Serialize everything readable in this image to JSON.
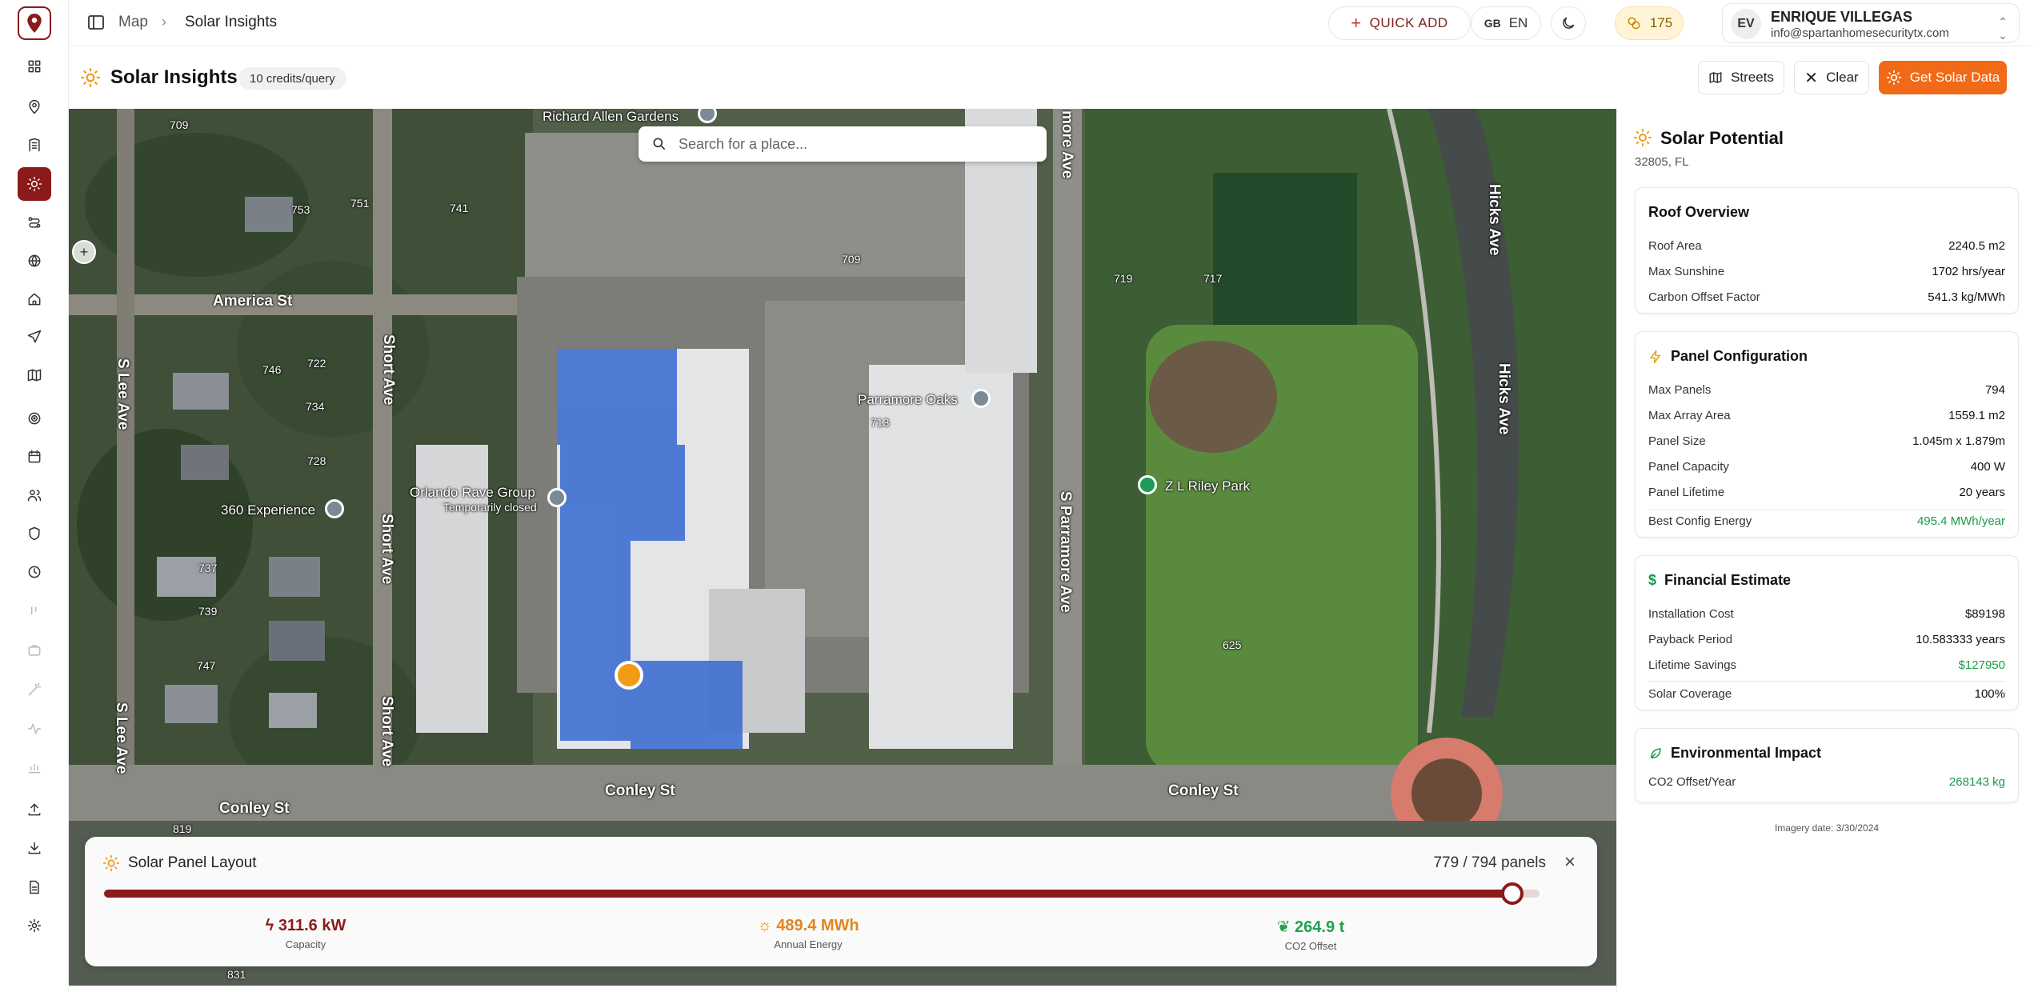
{
  "breadcrumb": {
    "parent": "Map",
    "current": "Solar Insights"
  },
  "header": {
    "quick_add": "QUICK ADD",
    "lang_flag": "GB",
    "lang_code": "EN",
    "credits": "175",
    "user_initials": "EV",
    "user_name": "ENRIQUE VILLEGAS",
    "user_email": "info@spartanhomesecuritytx.com"
  },
  "page": {
    "title": "Solar Insights",
    "credit_badge": "10 credits/query",
    "btn_streets": "Streets",
    "btn_clear": "Clear",
    "btn_get_solar": "Get Solar Data"
  },
  "map": {
    "search_placeholder": "Search for a place...",
    "labels": {
      "richard_allen": "Richard Allen Gardens",
      "america_st": "America St",
      "short_ave_1": "Short Ave",
      "short_ave_2": "Short Ave",
      "short_ave_3": "Short Ave",
      "s_lee_ave_1": "S Lee Ave",
      "s_lee_ave_2": "S Lee Ave",
      "experience": "360 Experience",
      "orlando_rave": "Orlando Rave Group",
      "temporarily_closed": "Temporarily closed",
      "parramore_oaks": "Parramore Oaks",
      "more_ave": "more Ave",
      "s_parramore": "S Parramore Ave",
      "zl_riley": "Z L Riley Park",
      "hicks_ave_1": "Hicks Ave",
      "hicks_ave_2": "Hicks Ave",
      "conley_st_1": "Conley St",
      "conley_st_2": "Conley St",
      "conley_st_3": "Conley St"
    },
    "numbers": {
      "n709a": "709",
      "n753": "753",
      "n751": "751",
      "n741": "741",
      "n709b": "709",
      "n719": "719",
      "n717": "717",
      "n722": "722",
      "n746": "746",
      "n734": "734",
      "n728": "728",
      "n713": "713",
      "n737": "737",
      "n739": "739",
      "n747": "747",
      "n625": "625",
      "n819": "819",
      "n831": "831"
    }
  },
  "layout_panel": {
    "title": "Solar Panel Layout",
    "count": "779 / 794 panels",
    "fill_fraction": 0.981,
    "capacity": "311.6 kW",
    "capacity_label": "Capacity",
    "energy": "489.4 MWh",
    "energy_label": "Annual Energy",
    "co2": "264.9 t",
    "co2_label": "CO2 Offset"
  },
  "solar_potential": {
    "title": "Solar Potential",
    "location": "32805, FL",
    "roof": {
      "title": "Roof Overview",
      "roof_area_k": "Roof Area",
      "roof_area_v": "2240.5 m2",
      "sunshine_k": "Max Sunshine",
      "sunshine_v": "1702 hrs/year",
      "carbon_k": "Carbon Offset Factor",
      "carbon_v": "541.3 kg/MWh"
    },
    "panel": {
      "title": "Panel Configuration",
      "max_panels_k": "Max Panels",
      "max_panels_v": "794",
      "array_area_k": "Max Array Area",
      "array_area_v": "1559.1 m2",
      "panel_size_k": "Panel Size",
      "panel_size_v": "1.045m x 1.879m",
      "capacity_k": "Panel Capacity",
      "capacity_v": "400 W",
      "lifetime_k": "Panel Lifetime",
      "lifetime_v": "20 years",
      "best_k": "Best Config Energy",
      "best_v": "495.4 MWh/year"
    },
    "financial": {
      "title": "Financial Estimate",
      "install_k": "Installation Cost",
      "install_v": "$89198",
      "payback_k": "Payback Period",
      "payback_v": "10.583333 years",
      "savings_k": "Lifetime Savings",
      "savings_v": "$127950",
      "coverage_k": "Solar Coverage",
      "coverage_v": "100%"
    },
    "environment": {
      "title": "Environmental Impact",
      "co2_k": "CO2 Offset/Year",
      "co2_v": "268143 kg"
    },
    "imagery": "Imagery date: 3/30/2024"
  },
  "colors": {
    "brand": "#8b1a1a",
    "accent_orange": "#f06a17",
    "green": "#1a9a4a"
  }
}
